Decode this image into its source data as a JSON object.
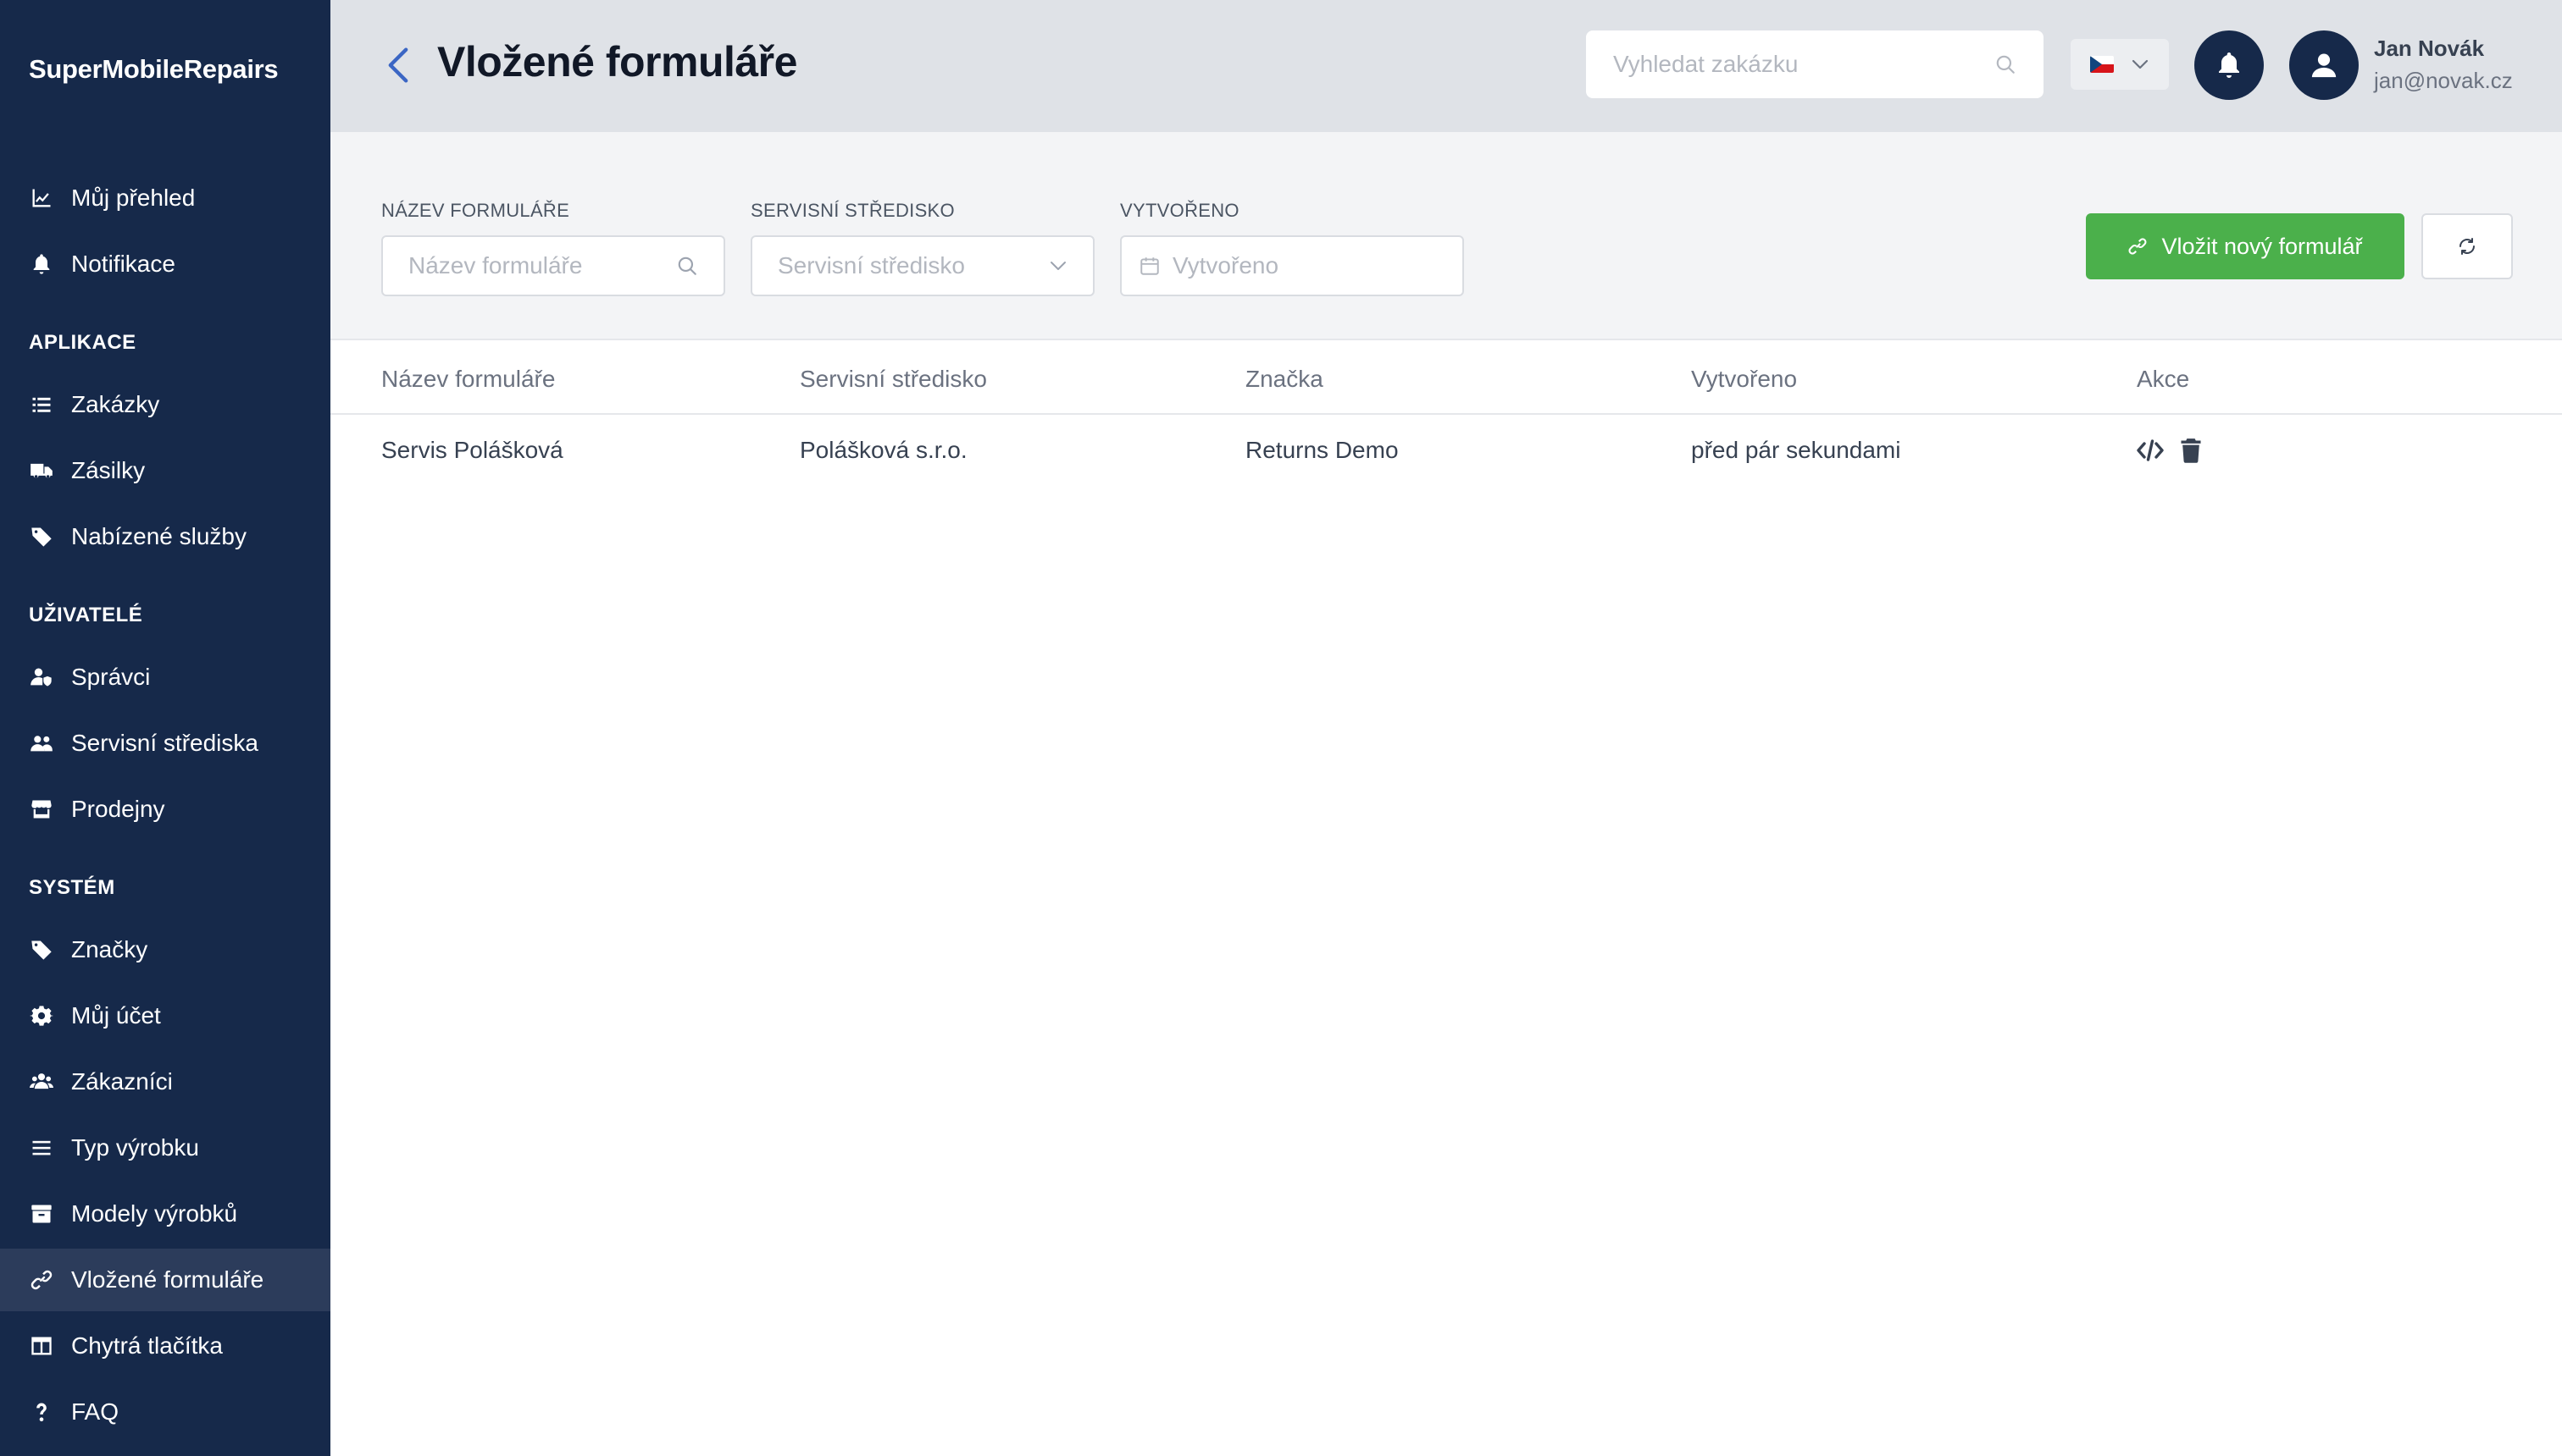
{
  "app": {
    "brand": "SuperMobileRepairs"
  },
  "sidebar": {
    "top_items": [
      {
        "label": "Můj přehled",
        "icon": "chart-line-icon"
      },
      {
        "label": "Notifikace",
        "icon": "bell-icon"
      }
    ],
    "sections": [
      {
        "title": "APLIKACE",
        "items": [
          {
            "label": "Zakázky",
            "icon": "list-icon"
          },
          {
            "label": "Zásilky",
            "icon": "truck-icon"
          },
          {
            "label": "Nabízené služby",
            "icon": "tag-icon"
          }
        ]
      },
      {
        "title": "UŽIVATELÉ",
        "items": [
          {
            "label": "Správci",
            "icon": "user-shield-icon"
          },
          {
            "label": "Servisní střediska",
            "icon": "users-icon"
          },
          {
            "label": "Prodejny",
            "icon": "store-icon"
          }
        ]
      },
      {
        "title": "SYSTÉM",
        "items": [
          {
            "label": "Značky",
            "icon": "tag-icon"
          },
          {
            "label": "Můj účet",
            "icon": "gear-icon"
          },
          {
            "label": "Zákazníci",
            "icon": "user-group-icon"
          },
          {
            "label": "Typ výrobku",
            "icon": "bars-icon"
          },
          {
            "label": "Modely výrobků",
            "icon": "archive-icon"
          },
          {
            "label": "Vložené formuláře",
            "icon": "link-icon",
            "active": true
          },
          {
            "label": "Chytrá tlačítka",
            "icon": "table-columns-icon"
          },
          {
            "label": "FAQ",
            "icon": "question-icon"
          }
        ]
      }
    ]
  },
  "header": {
    "title": "Vložené formuláře",
    "search_placeholder": "Vyhledat zakázku",
    "language": "cs",
    "user": {
      "name": "Jan Novák",
      "email": "jan@novak.cz"
    }
  },
  "filters": {
    "name": {
      "label": "NÁZEV FORMULÁŘE",
      "placeholder": "Název formuláře"
    },
    "center": {
      "label": "SERVISNÍ STŘEDISKO",
      "placeholder": "Servisní středisko"
    },
    "created": {
      "label": "VYTVOŘENO",
      "placeholder": "Vytvořeno"
    }
  },
  "actions": {
    "add_label": "Vložit nový formulář"
  },
  "table": {
    "columns": [
      "Název formuláře",
      "Servisní středisko",
      "Značka",
      "Vytvořeno",
      "Akce"
    ],
    "rows": [
      {
        "name": "Servis Polášková",
        "center": "Polášková s.r.o.",
        "brand": "Returns Demo",
        "created": "před pár sekundami"
      }
    ]
  },
  "colors": {
    "sidebar": "#16294a",
    "sidebar_active": "#2c3c5b",
    "primary": "#4bb04b",
    "header": "#dfe2e7",
    "accent": "#3b66c4"
  }
}
